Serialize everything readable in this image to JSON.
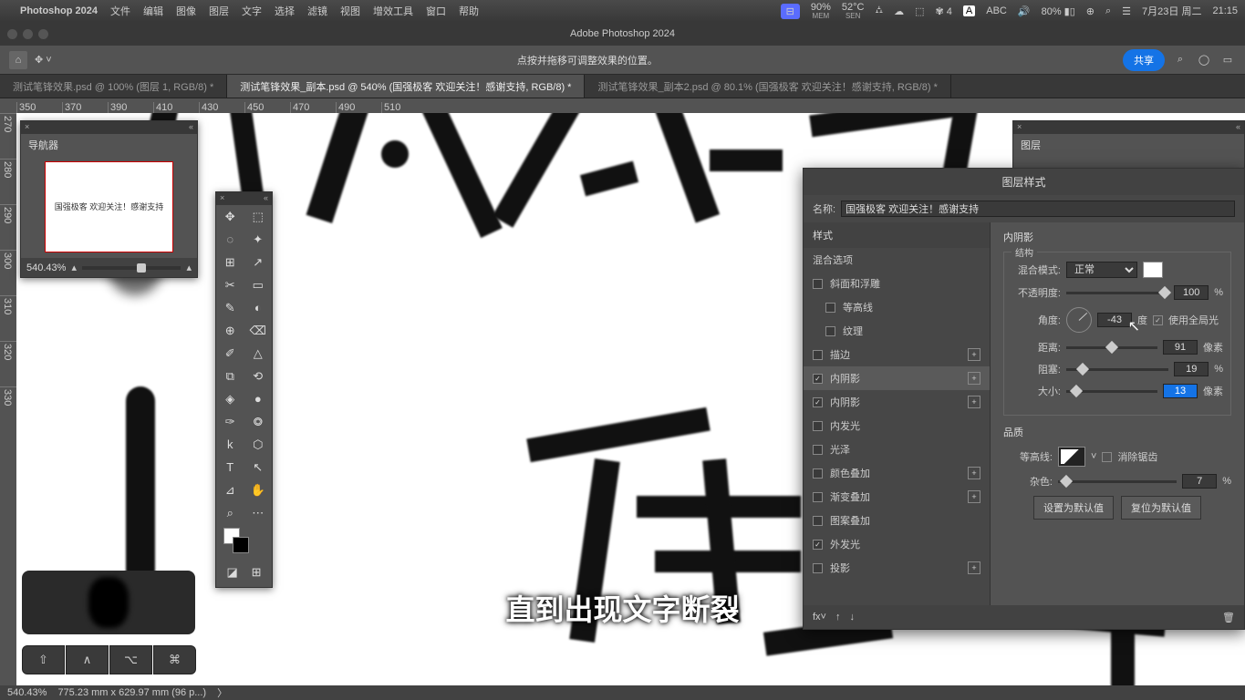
{
  "menubar": {
    "app": "Photoshop 2024",
    "items": [
      "文件",
      "编辑",
      "图像",
      "图层",
      "文字",
      "选择",
      "滤镜",
      "视图",
      "增效工具",
      "窗口",
      "帮助"
    ],
    "stats": [
      {
        "v": "90%",
        "s": "MEM"
      },
      {
        "v": "52°C",
        "s": "SEN"
      }
    ],
    "wechat": "4",
    "abc": "ABC",
    "battery": "80%",
    "date": "7月23日 周二",
    "time": "21:15"
  },
  "title": "Adobe Photoshop 2024",
  "optbar": {
    "hint": "点按并拖移可调整效果的位置。",
    "share": "共享"
  },
  "tabs": [
    {
      "label": "测试笔锋效果.psd @ 100% (图层 1, RGB/8) *",
      "active": false
    },
    {
      "label": "测试笔锋效果_副本.psd @ 540% (国强极客 欢迎关注！感谢支持, RGB/8) *",
      "active": true
    },
    {
      "label": "测试笔锋效果_副本2.psd @ 80.1% (国强极客 欢迎关注！感谢支持, RGB/8) *",
      "active": false
    }
  ],
  "ruler_h": [
    "350",
    "370",
    "390",
    "410",
    "430",
    "450",
    "470",
    "490",
    "510"
  ],
  "ruler_v": [
    "270",
    "280",
    "290",
    "300",
    "310",
    "320",
    "330"
  ],
  "navigator": {
    "title": "导航器",
    "zoom": "540.43%",
    "thumb_text": "国强极客\n欢迎关注！感谢支持"
  },
  "tools": [
    "✥",
    "⬚",
    "◌",
    "✦",
    "⊞",
    "↗",
    "✂",
    "▭",
    "✎",
    "◐",
    "⊕",
    "⌫",
    "✐",
    "△",
    "⧉",
    "⟲",
    "◈",
    "●",
    "✑",
    "⭗",
    "k",
    "⬡",
    "T",
    "↖",
    "⊿",
    "✋",
    "⌕",
    "⋯"
  ],
  "layers": {
    "title": "图层"
  },
  "layerstyle": {
    "title": "图层样式",
    "name_lbl": "名称:",
    "name": "国强极客 欢迎关注！感谢支持",
    "styles_hd": "样式",
    "blend_opts": "混合选项",
    "effects": [
      {
        "label": "斜面和浮雕",
        "on": false
      },
      {
        "label": "等高线",
        "on": false,
        "sub": true
      },
      {
        "label": "纹理",
        "on": false,
        "sub": true
      },
      {
        "label": "描边",
        "on": false,
        "plus": true
      },
      {
        "label": "内阴影",
        "on": true,
        "sel": true,
        "plus": true
      },
      {
        "label": "内阴影",
        "on": true,
        "plus": true
      },
      {
        "label": "内发光",
        "on": false
      },
      {
        "label": "光泽",
        "on": false
      },
      {
        "label": "颜色叠加",
        "on": false,
        "plus": true
      },
      {
        "label": "渐变叠加",
        "on": false,
        "plus": true
      },
      {
        "label": "图案叠加",
        "on": false
      },
      {
        "label": "外发光",
        "on": true
      },
      {
        "label": "投影",
        "on": false,
        "plus": true
      }
    ],
    "right": {
      "section": "内阴影",
      "structure": "结构",
      "blend_lbl": "混合模式:",
      "blend": "正常",
      "opacity_lbl": "不透明度:",
      "opacity": "100",
      "opacity_u": "%",
      "angle_lbl": "角度:",
      "angle": "-43",
      "angle_u": "度",
      "global_lbl": "使用全局光",
      "global": true,
      "dist_lbl": "距离:",
      "dist": "91",
      "dist_u": "像素",
      "choke_lbl": "阻塞:",
      "choke": "19",
      "choke_u": "%",
      "size_lbl": "大小:",
      "size": "13",
      "size_u": "像素",
      "quality": "品质",
      "contour_lbl": "等高线:",
      "anti_lbl": "消除锯齿",
      "anti": false,
      "noise_lbl": "杂色:",
      "noise": "7",
      "noise_u": "%",
      "btn_default": "设置为默认值",
      "btn_reset": "复位为默认值"
    }
  },
  "subtitle": "直到出现文字断裂",
  "modkeys": [
    "⇧",
    "∧",
    "⌥",
    "⌘"
  ],
  "status": {
    "zoom": "540.43%",
    "dims": "775.23 mm x 629.97 mm (96 p...)"
  }
}
